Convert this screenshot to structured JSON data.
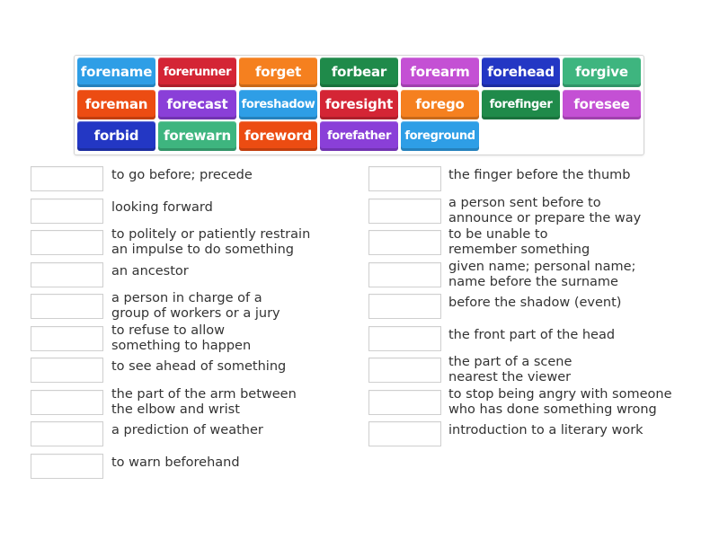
{
  "word_bank": {
    "tiles": [
      {
        "word": "forename",
        "color": "#2e9ee6"
      },
      {
        "word": "forerunner",
        "color": "#d42535"
      },
      {
        "word": "forget",
        "color": "#f5801f"
      },
      {
        "word": "forbear",
        "color": "#1f8a4a"
      },
      {
        "word": "forearm",
        "color": "#c450d4"
      },
      {
        "word": "forehead",
        "color": "#2337c4"
      },
      {
        "word": "forgive",
        "color": "#3eb57f"
      },
      {
        "word": "foreman",
        "color": "#ec4c12"
      },
      {
        "word": "forecast",
        "color": "#8a3fd8"
      },
      {
        "word": "foreshadow",
        "color": "#2e9ee6"
      },
      {
        "word": "foresight",
        "color": "#d42535"
      },
      {
        "word": "forego",
        "color": "#f5801f"
      },
      {
        "word": "forefinger",
        "color": "#1f8a4a"
      },
      {
        "word": "foresee",
        "color": "#c450d4"
      },
      {
        "word": "forbid",
        "color": "#2337c4"
      },
      {
        "word": "forewarn",
        "color": "#3eb57f"
      },
      {
        "word": "foreword",
        "color": "#ec4c12"
      },
      {
        "word": "forefather",
        "color": "#8a3fd8"
      },
      {
        "word": "foreground",
        "color": "#2e9ee6"
      }
    ]
  },
  "definitions": {
    "left": [
      {
        "lines": [
          "to go before; precede"
        ],
        "answer": ""
      },
      {
        "lines": [
          "looking forward"
        ],
        "answer": ""
      },
      {
        "lines": [
          "to politely or patiently restrain",
          "an impulse to do something"
        ],
        "answer": ""
      },
      {
        "lines": [
          "an ancestor"
        ],
        "answer": ""
      },
      {
        "lines": [
          "a person in charge of a",
          "group of workers or a jury"
        ],
        "answer": ""
      },
      {
        "lines": [
          "to refuse to allow",
          "something to happen"
        ],
        "answer": ""
      },
      {
        "lines": [
          "to see ahead of something"
        ],
        "answer": ""
      },
      {
        "lines": [
          "the part of the arm between",
          "the elbow and wrist"
        ],
        "answer": ""
      },
      {
        "lines": [
          "a prediction of weather"
        ],
        "answer": ""
      },
      {
        "lines": [
          "to warn beforehand"
        ],
        "answer": ""
      }
    ],
    "right": [
      {
        "lines": [
          "the finger before the thumb"
        ],
        "answer": ""
      },
      {
        "lines": [
          "a person sent before to",
          "announce or prepare the way"
        ],
        "answer": ""
      },
      {
        "lines": [
          "to be unable to",
          "remember something"
        ],
        "answer": ""
      },
      {
        "lines": [
          "given name; personal name;",
          "name before the surname"
        ],
        "answer": ""
      },
      {
        "lines": [
          "before the shadow (event)"
        ],
        "answer": ""
      },
      {
        "lines": [
          "the front part of the head"
        ],
        "answer": ""
      },
      {
        "lines": [
          "the part of a scene",
          "nearest the viewer"
        ],
        "answer": ""
      },
      {
        "lines": [
          "to stop being angry with someone",
          "who has done something wrong"
        ],
        "answer": ""
      },
      {
        "lines": [
          "introduction to a literary work"
        ],
        "answer": ""
      }
    ]
  }
}
